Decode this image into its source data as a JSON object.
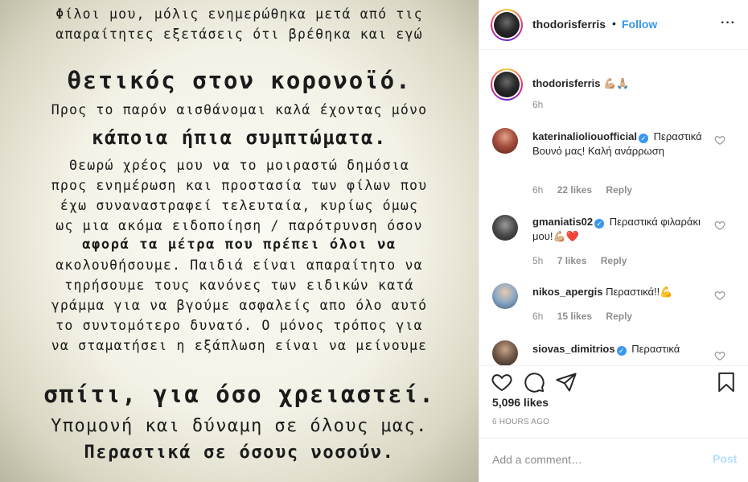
{
  "post_image": {
    "lines": [
      "Φίλοι μου, μόλις ενημερώθηκα μετά από τις",
      "απαραίτητες εξετάσεις ότι βρέθηκα και εγώ",
      "θετικός στον κορονοϊό.",
      "Προς το παρόν αισθάνομαι καλά έχοντας μόνο",
      "κάποια ήπια συμπτώματα.",
      "Θεωρώ χρέος μου να το μοιραστώ δημόσια",
      "προς ενημέρωση και προστασία των φίλων που",
      "έχω συναναστραφεί τελευταία, κυρίως όμως",
      "ως μια ακόμα ειδοποίηση / παρότρυνση όσον",
      "αφορά τα μέτρα που πρέπει όλοι να",
      "ακολουθήσουμε. Παιδιά είναι απαραίτητο να",
      "τηρήσουμε τους κανόνες των ειδικών κατά",
      "γράμμα για να βγούμε ασφαλείς απο όλο αυτό",
      "το συντομότερο δυνατό. Ο μόνος τρόπος για",
      "να σταματήσει η εξάπλωση είναι να μείνουμε",
      "σπίτι, για όσο χρειαστεί.",
      "Υπομονή και δύναμη σε όλους μας.",
      "Περαστικά σε όσους νοσούν."
    ]
  },
  "header": {
    "username": "thodorisferris",
    "separator": "•",
    "follow_label": "Follow",
    "more_label": "···"
  },
  "caption": {
    "username": "thodorisferris",
    "text": "💪🏼🙏🏼",
    "time": "6h"
  },
  "comments": [
    {
      "username": "katerinalioliouofficial",
      "verified": true,
      "text": "Περαστικά Βουνό μας! Καλή ανάρρωση",
      "time": "6h",
      "likes": "22 likes",
      "reply": "Reply"
    },
    {
      "username": "gmaniatis02",
      "verified": true,
      "text": "Περαστικά φιλαράκι μου!💪🏼❤️",
      "time": "5h",
      "likes": "7 likes",
      "reply": "Reply"
    },
    {
      "username": "nikos_apergis",
      "verified": false,
      "text": "Περαστικά!!💪",
      "time": "6h",
      "likes": "15 likes",
      "reply": "Reply"
    },
    {
      "username": "siovas_dimitrios",
      "verified": true,
      "text": "Περαστικά",
      "time": "",
      "likes": "",
      "reply": ""
    }
  ],
  "actions": {
    "likes_count": "5,096 likes",
    "posted_ago": "6 HOURS AGO"
  },
  "add_comment": {
    "placeholder": "Add a comment…",
    "post_label": "Post"
  },
  "colors": {
    "link_blue": "#3897f0",
    "post_disabled": "#b2dffc",
    "meta_gray": "#8e8e8e",
    "like_red": "#ed4956"
  },
  "icons": [
    "heart-icon",
    "comment-icon",
    "share-icon",
    "bookmark-icon",
    "more-options-icon",
    "verified-badge-icon"
  ]
}
